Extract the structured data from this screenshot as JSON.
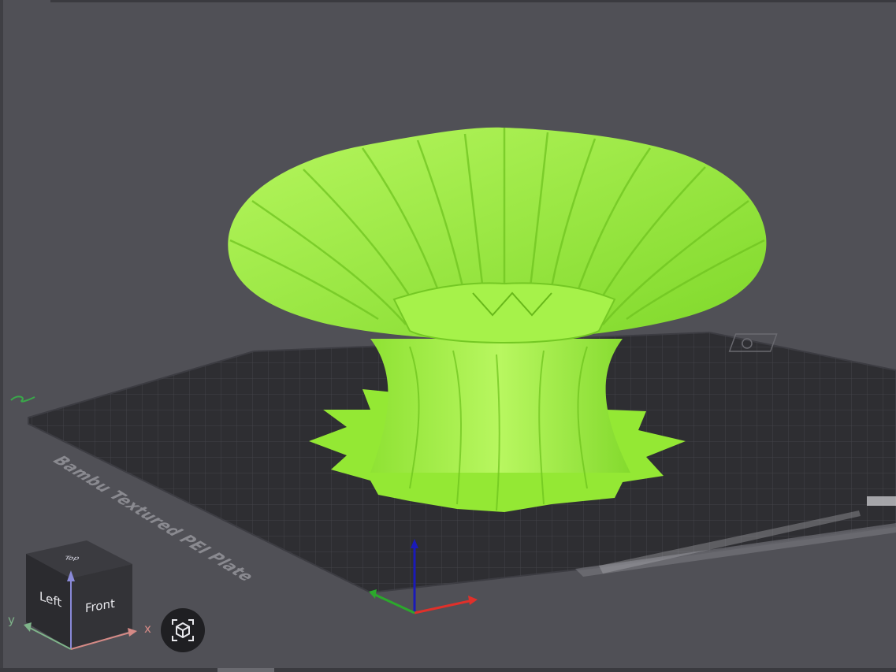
{
  "plate": {
    "label": "Bambu Textured PEI Plate"
  },
  "view_cube": {
    "front_label": "Front",
    "left_label": "Left",
    "top_label": "Top"
  },
  "axes": {
    "x_label": "x",
    "y_label": "y"
  },
  "icons": {
    "view_button": "view-cube-reset-icon",
    "plate_settings": "plate-settings-icon"
  },
  "colors": {
    "model": "#9bef3c",
    "viewport_bg": "#505056",
    "plate": "#303034",
    "axis_x": "#e0302a",
    "axis_y": "#2ca82c",
    "axis_z": "#1a1ab8"
  }
}
